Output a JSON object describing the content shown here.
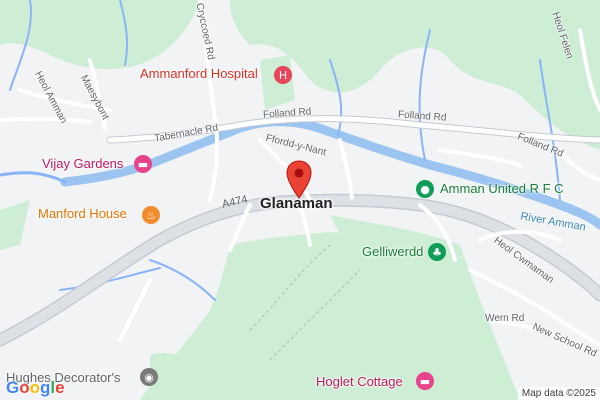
{
  "map": {
    "town": "Glanaman",
    "road_shield": "A474",
    "attribution": "Map data ©2025",
    "logo": [
      "G",
      "o",
      "o",
      "g",
      "l",
      "e"
    ],
    "pin_color": "#ea4335",
    "road_labels": {
      "cryccoed": "Cryccoed Rd",
      "heol_felen": "Heol Felen",
      "heol_amman": "Heol Amman",
      "maesybont": "Maesybont",
      "folland_1": "Folland Rd",
      "folland_2": "Folland Rd",
      "folland_3": "Folland Rd",
      "tabernacle": "Tabernacle Rd",
      "ffordd": "Ffordd-y-Nant",
      "heol_cwmaman": "Heol Cwmaman",
      "wern": "Wern Rd",
      "new_school": "New School Rd"
    },
    "water_labels": {
      "river_amman": "River Amman"
    },
    "pois": {
      "hospital": {
        "label": "Ammanford Hospital",
        "icon": "hospital-icon",
        "color": "#e8445a"
      },
      "vijay": {
        "label": "Vijay Gardens",
        "icon": "hotel-icon",
        "color": "#e8438b"
      },
      "manford": {
        "label": "Manford House",
        "icon": "restaurant-icon",
        "color": "#f28b2c"
      },
      "amman_united": {
        "label": "Amman United R F C",
        "icon": "stadium-icon",
        "color": "#0f9d58"
      },
      "gelliwerdd": {
        "label": "Gelliwerdd",
        "icon": "tree-icon",
        "color": "#0f9d58"
      },
      "hughes": {
        "label": "Hughes Decorator's",
        "icon": "shop-icon",
        "color": "#7a7a7a"
      },
      "hoglet": {
        "label": "Hoglet Cottage",
        "icon": "hotel-icon",
        "color": "#e8438b"
      }
    }
  }
}
